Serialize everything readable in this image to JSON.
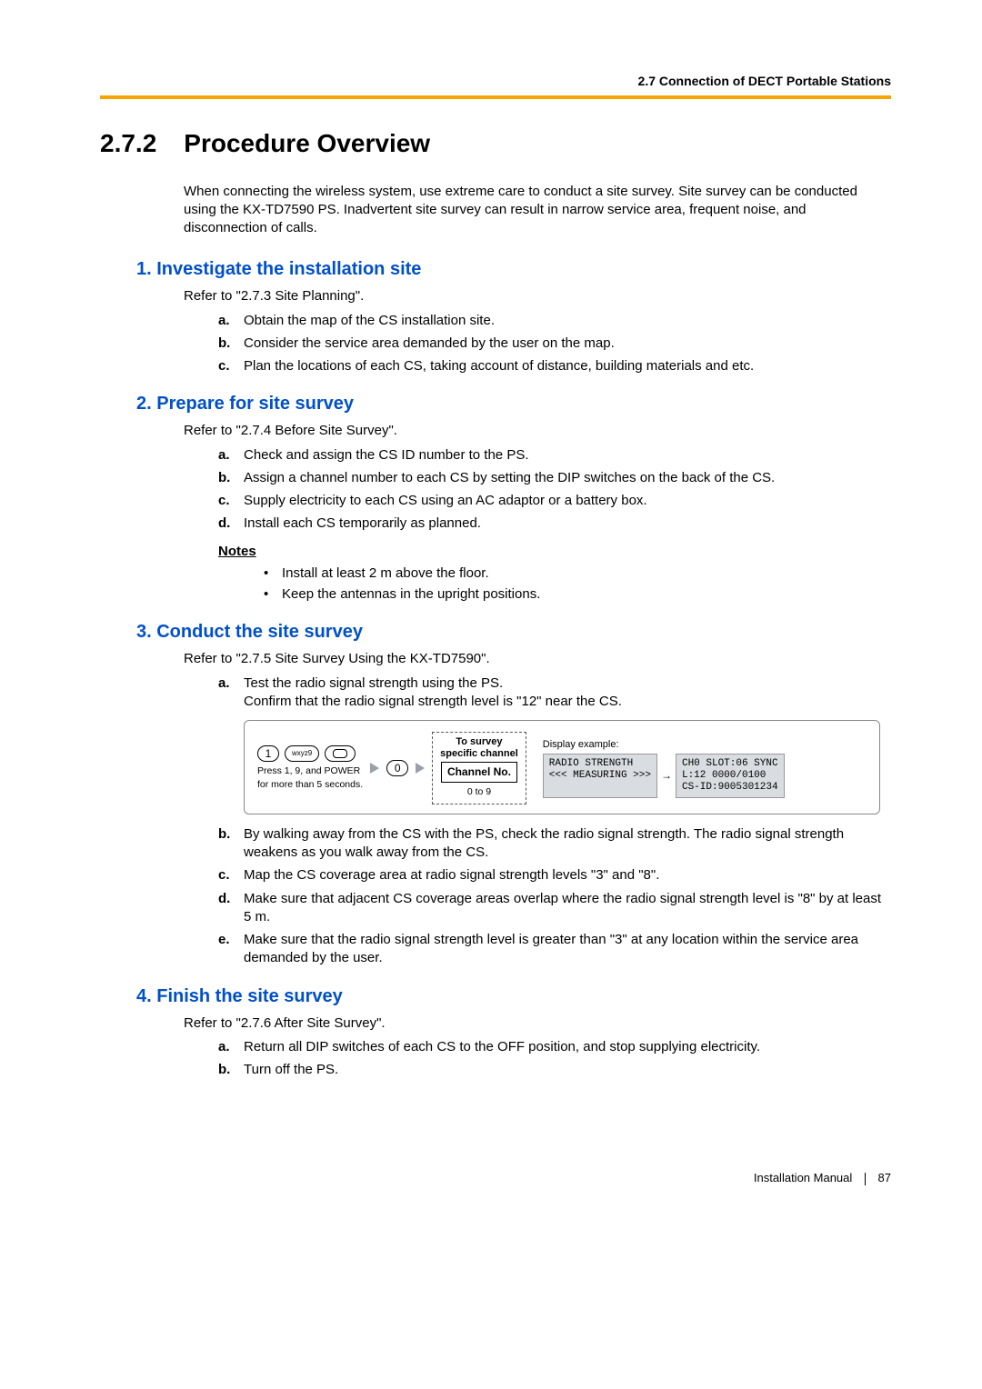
{
  "header": {
    "section_label": "2.7 Connection of DECT Portable Stations"
  },
  "title": {
    "number": "2.7.2",
    "text": "Procedure Overview"
  },
  "intro": "When connecting the wireless system, use extreme care to conduct a site survey. Site survey can be conducted using the KX-TD7590 PS. Inadvertent site survey can result in narrow service area, frequent noise, and disconnection of calls.",
  "steps": [
    {
      "heading": "1. Investigate the installation site",
      "refer": "Refer to \"2.7.3 Site Planning\".",
      "items": [
        "Obtain the map of the CS installation site.",
        "Consider the service area demanded by the user on the map.",
        "Plan the locations of each CS, taking account of distance, building materials and etc."
      ]
    },
    {
      "heading": "2. Prepare for site survey",
      "refer": "Refer to \"2.7.4 Before Site Survey\".",
      "items": [
        "Check and assign the CS ID number to the PS.",
        "Assign a channel number to each CS by setting the DIP switches on the back of the CS.",
        "Supply electricity to each CS using an AC adaptor or a battery box.",
        "Install each CS temporarily as planned."
      ],
      "notes_label": "Notes",
      "notes": [
        "Install at least 2 m above the floor.",
        "Keep the antennas in the upright positions."
      ]
    },
    {
      "heading": "3. Conduct the site survey",
      "refer": "Refer to \"2.7.5 Site Survey Using the KX-TD7590\".",
      "items_pre": [
        "Test the radio signal strength using the PS.\nConfirm that the radio signal strength level is \"12\" near the CS."
      ],
      "items_post": [
        "By walking away from the CS with the PS, check the radio signal strength. The radio signal strength weakens as you walk away from the CS.",
        "Map the CS coverage area at radio signal strength levels \"3\" and \"8\".",
        "Make sure that adjacent CS coverage areas overlap where the radio signal strength level is \"8\" by at least 5 m.",
        "Make sure that the radio signal strength level is greater than \"3\" at any location within the service area demanded by the user."
      ]
    },
    {
      "heading": "4. Finish the site survey",
      "refer": "Refer to \"2.7.6 After Site Survey\".",
      "items": [
        "Return all DIP switches of each CS to the OFF position, and stop supplying electricity.",
        "Turn off the PS."
      ]
    }
  ],
  "diagram": {
    "keys": {
      "k1": "1",
      "k9": "wxyz9",
      "k0": "0"
    },
    "hold_caption": "Press 1, 9, and POWER\nfor more than 5 seconds.",
    "dashed_label": "To survey\nspecific channel",
    "channel_box": "Channel No.",
    "channel_range": "0 to 9",
    "display_label": "Display example:",
    "display_left": "RADIO STRENGTH\n<<< MEASURING >>>",
    "display_right": "CH0 SLOT:06 SYNC\nL:12 0000/0100\nCS-ID:9005301234"
  },
  "footer": {
    "manual": "Installation Manual",
    "page": "87"
  },
  "alpha_markers": [
    "a.",
    "b.",
    "c.",
    "d.",
    "e."
  ]
}
